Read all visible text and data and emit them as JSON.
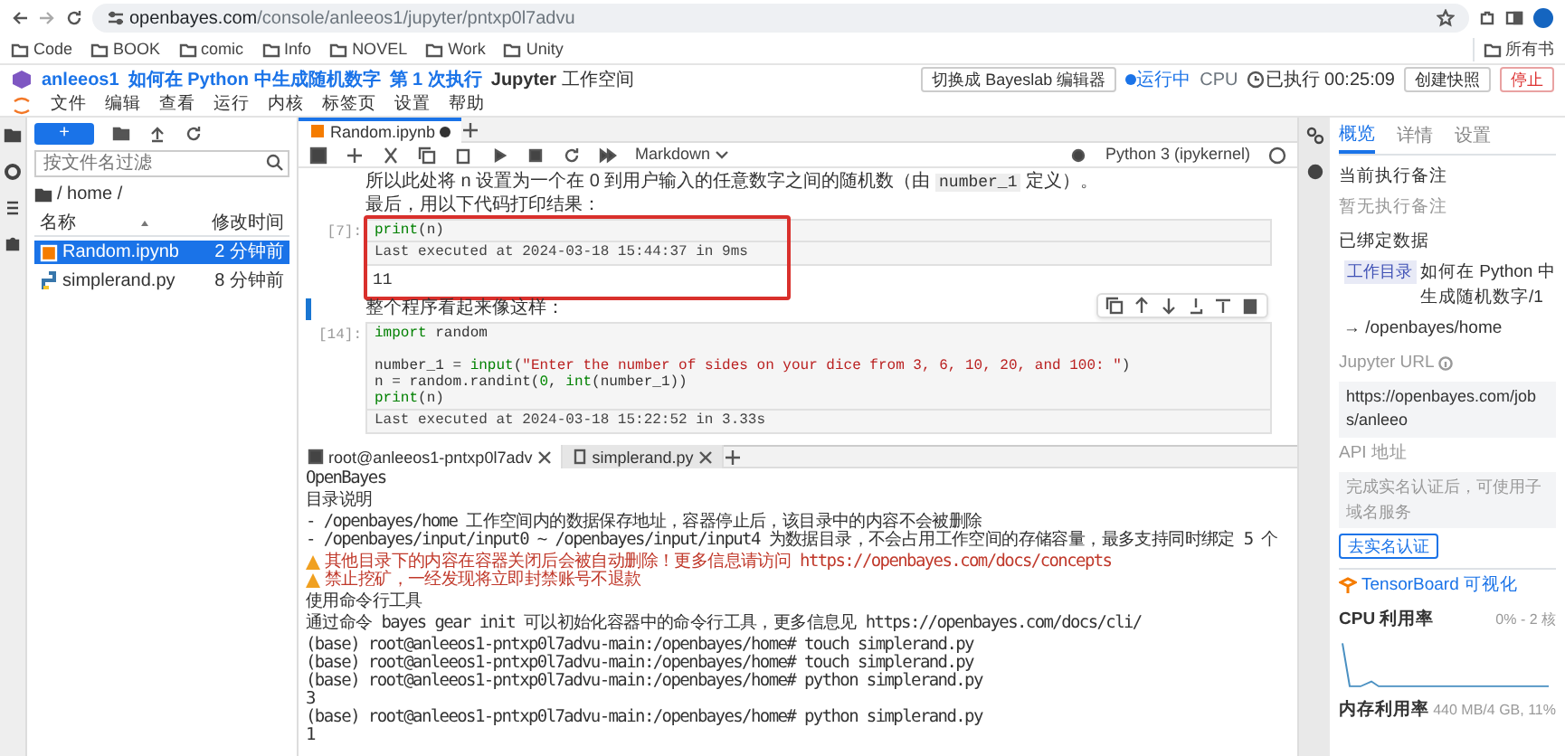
{
  "browser": {
    "url_host": "openbayes.com",
    "url_path": "/console/anleeos1/jupyter/pntxp0l7advu",
    "bookmarks": [
      "Code",
      "BOOK",
      "comic",
      "Info",
      "NOVEL",
      "Work",
      "Unity"
    ],
    "bookmark_overflow": "所有书"
  },
  "app_header": {
    "workspace": "anleeos1",
    "title": "如何在 Python 中生成随机数字",
    "run": "第 1 次执行",
    "mode_name": "Jupyter",
    "mode": "工作空间",
    "switch_button": "切换成 Bayeslab 编辑器",
    "status": "运行中",
    "cpu": "CPU",
    "elapsed": "已执行 00:25:09",
    "snapshot_button": "创建快照",
    "stop_button": "停止"
  },
  "menu": [
    "文件",
    "编辑",
    "查看",
    "运行",
    "内核",
    "标签页",
    "设置",
    "帮助"
  ],
  "file_browser": {
    "new_button": "+",
    "filter_placeholder": "按文件名过滤",
    "path": "/ home /",
    "columns": [
      "名称",
      "修改时间"
    ],
    "files": [
      {
        "name": "Random.ipynb",
        "modified": "2 分钟前",
        "kind": "notebook",
        "selected": true
      },
      {
        "name": "simplerand.py",
        "modified": "8 分钟前",
        "kind": "python",
        "selected": false
      }
    ]
  },
  "notebook": {
    "tab": "Random.ipynb",
    "cell_type": "Markdown",
    "kernel": "Python 3 (ipykernel)",
    "cells": [
      {
        "kind": "markdown",
        "active": false,
        "paragraphs": [
          [
            {
              "text": "所以此处将 n 设置为一个在 0 到用户输入的任意数字之间的随机数（由 "
            },
            {
              "code": "number_1"
            },
            {
              "text": " 定义）。"
            }
          ],
          [
            {
              "text": "最后，用以下代码打印结果："
            }
          ]
        ]
      },
      {
        "kind": "code",
        "highlighted": true,
        "prompt": "[7]:",
        "code_blocks": [
          [
            [
              {
                "t": "print",
                "kind": "builtin"
              },
              {
                "t": "(n)",
                "kind": "plain"
              }
            ]
          ]
        ],
        "executed": "Last executed at 2024-03-18 15:44:37 in 9ms",
        "output": "11"
      },
      {
        "kind": "markdown",
        "active": true,
        "paragraphs": [
          [
            {
              "text": "整个程序看起来像这样："
            }
          ]
        ]
      },
      {
        "kind": "code",
        "highlighted": false,
        "prompt": "[14]:",
        "code_blocks": [
          [
            [
              {
                "t": "import",
                "kind": "keyword"
              },
              {
                "t": " random",
                "kind": "plain"
              }
            ]
          ],
          [
            [
              {
                "t": "number_1 = ",
                "kind": "plain"
              },
              {
                "t": "input",
                "kind": "builtin"
              },
              {
                "t": "(",
                "kind": "plain"
              },
              {
                "t": "\"Enter the number of sides on your dice from 3, 6, 10, 20, and 100: \"",
                "kind": "string"
              },
              {
                "t": ")",
                "kind": "plain"
              }
            ],
            [
              {
                "t": "n = random.randint(",
                "kind": "plain"
              },
              {
                "t": "0",
                "kind": "number"
              },
              {
                "t": ", ",
                "kind": "plain"
              },
              {
                "t": "int",
                "kind": "builtin"
              },
              {
                "t": "(number_1))",
                "kind": "plain"
              }
            ],
            [
              {
                "t": "print",
                "kind": "builtin"
              },
              {
                "t": "(n)",
                "kind": "plain"
              }
            ]
          ]
        ],
        "executed": "Last executed at 2024-03-18 15:22:52 in 3.33s"
      }
    ]
  },
  "terminal": {
    "tabs": [
      {
        "title": "root@anleeos1-pntxp0l7adv",
        "kind": "terminal",
        "selected": true
      },
      {
        "title": "simplerand.py",
        "kind": "file",
        "selected": false
      }
    ],
    "blocks": [
      [
        {
          "kind": "text",
          "text": "OpenBayes"
        }
      ],
      [
        {
          "kind": "text",
          "text": "目录说明"
        }
      ],
      [
        {
          "kind": "text",
          "text": "- /openbayes/home 工作空间内的数据保存地址，容器停止后，该目录中的内容不会被删除"
        },
        {
          "kind": "text",
          "text": "- /openbayes/input/input0 ~ /openbayes/input/input4 为数据目录，不会占用工作空间的存储容量，最多支持同时绑定 5 个"
        }
      ],
      [
        {
          "kind": "warning",
          "text": "其他目录下的内容在容器关闭后会被自动删除！更多信息请访问 https://openbayes.com/docs/concepts"
        },
        {
          "kind": "warning",
          "text": "禁止挖矿，一经发现将立即封禁账号不退款"
        }
      ],
      [
        {
          "kind": "text",
          "text": "使用命令行工具"
        }
      ],
      [
        {
          "kind": "text",
          "text": "通过命令 bayes gear init 可以初始化容器中的命令行工具，更多信息见 https://openbayes.com/docs/cli/"
        }
      ],
      [
        {
          "kind": "text",
          "text": "(base) root@anleeos1-pntxp0l7advu-main:/openbayes/home# touch simplerand.py"
        },
        {
          "kind": "text",
          "text": "(base) root@anleeos1-pntxp0l7advu-main:/openbayes/home# touch simplerand.py"
        },
        {
          "kind": "text",
          "text": "(base) root@anleeos1-pntxp0l7advu-main:/openbayes/home# python simplerand.py"
        },
        {
          "kind": "text",
          "text": "3"
        },
        {
          "kind": "text",
          "text": "(base) root@anleeos1-pntxp0l7advu-main:/openbayes/home# python simplerand.py"
        },
        {
          "kind": "text",
          "text": "1"
        }
      ]
    ]
  },
  "side_panel": {
    "tabs": [
      {
        "label": "概览",
        "selected": true
      },
      {
        "label": "详情",
        "selected": false
      },
      {
        "label": "设置",
        "selected": false
      }
    ],
    "note_title": "当前执行备注",
    "note": "暂无执行备注",
    "data_title": "已绑定数据",
    "data_tag": "工作目录",
    "data_name": "如何在 Python 中生成随机数字/1",
    "data_path": "→ /openbayes/home",
    "url_label": "Jupyter URL",
    "url_value": "https://openbayes.com/jobs/anleeo",
    "api_label": "API 地址",
    "api_value": "完成实名认证后，可使用子域名服务",
    "verify_button": "去实名认证",
    "tensorboard": "TensorBoard 可视化",
    "cpu_label": "CPU 利用率",
    "cpu_value": "0% - 2 核",
    "mem_label": "内存利用率",
    "mem_value": "440 MB/4 GB, 11%"
  }
}
